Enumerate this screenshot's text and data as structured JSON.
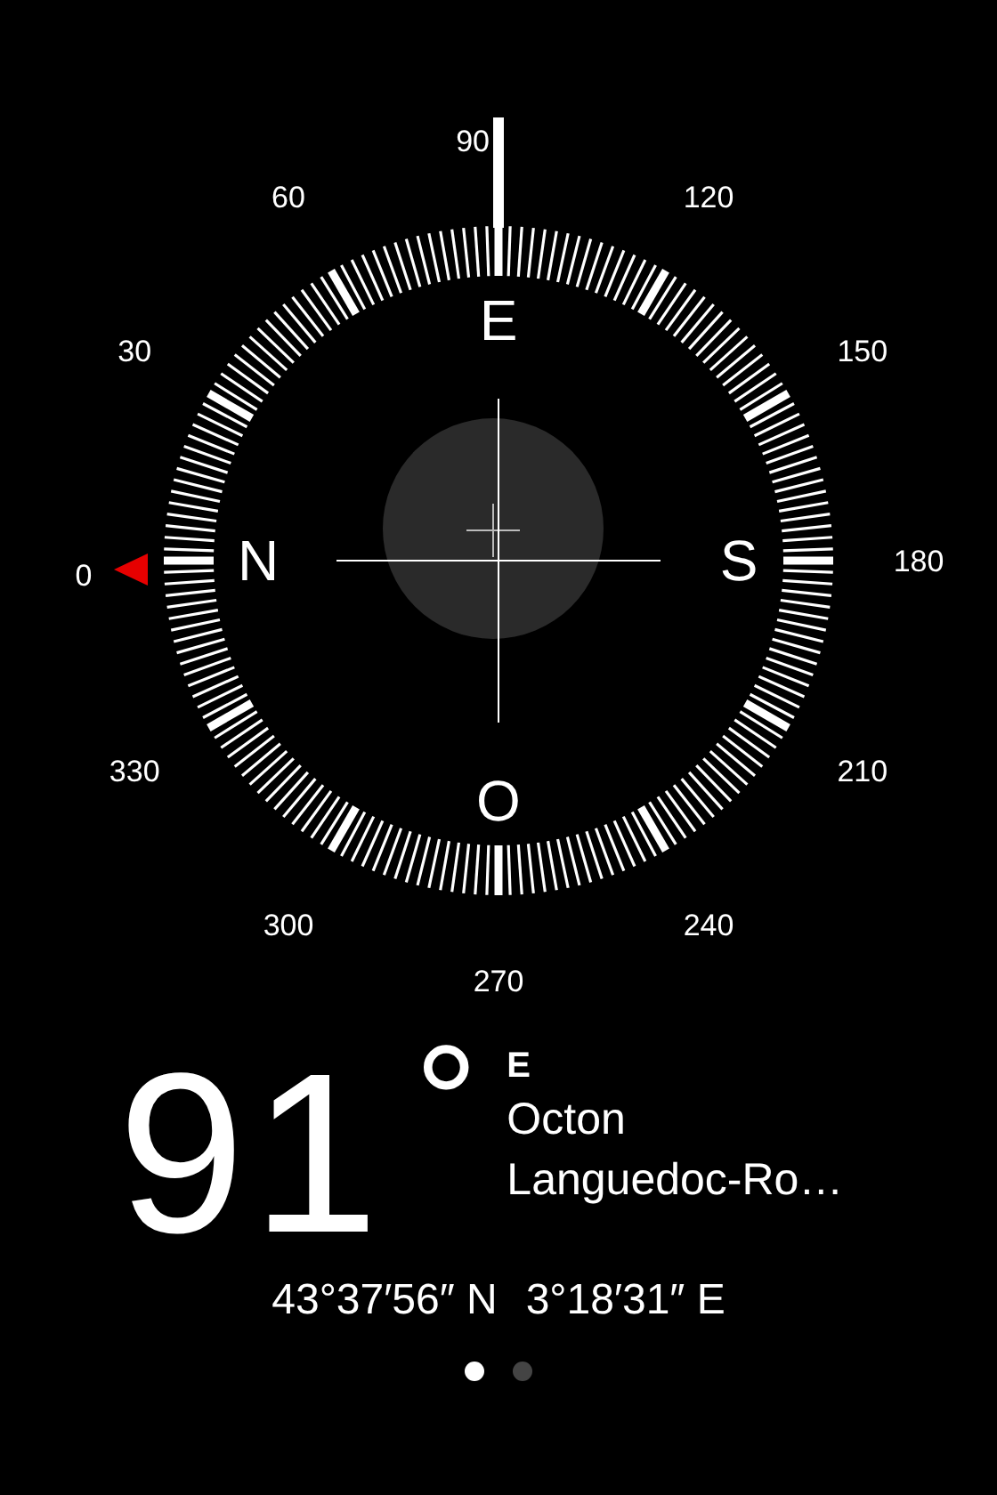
{
  "compass": {
    "degree_labels": [
      "0",
      "30",
      "60",
      "90",
      "120",
      "150",
      "180",
      "210",
      "240",
      "270",
      "300",
      "330"
    ],
    "cardinal_labels": [
      "N",
      "E",
      "S",
      "O"
    ]
  },
  "heading": {
    "value": "91",
    "degree_sign": "°",
    "direction": "E"
  },
  "location": {
    "place": "Octon",
    "region": "Languedoc-Ro…"
  },
  "coordinates": [
    "43°37′56″ N",
    "3°18′31″ E"
  ],
  "page_dots": [
    {
      "selected": true
    },
    {
      "selected": false
    }
  ]
}
